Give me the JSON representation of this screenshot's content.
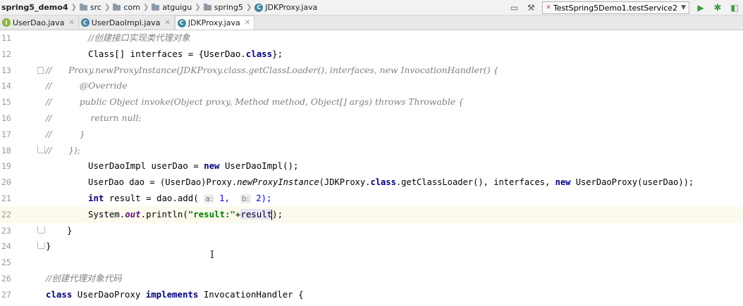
{
  "breadcrumb": {
    "project": "spring5_demo4",
    "items": [
      "src",
      "com",
      "atguigu",
      "spring5"
    ],
    "file": "JDKProxy.java"
  },
  "toolbar": {
    "run_config": "TestSpring5Demo1.testService2"
  },
  "tabs": [
    {
      "label": "UserDao.java",
      "kind": "interface",
      "active": false
    },
    {
      "label": "UserDaoImpl.java",
      "kind": "class",
      "active": false
    },
    {
      "label": "JDKProxy.java",
      "kind": "class",
      "active": true
    }
  ],
  "editor": {
    "line_numbers": [
      "11",
      "12",
      "13",
      "14",
      "15",
      "16",
      "17",
      "18",
      "19",
      "20",
      "21",
      "22",
      "23",
      "24",
      "25",
      "26",
      "27"
    ],
    "lines": {
      "l11": "//创建接口实现类代理对象",
      "l12a": "Class[] interfaces = {UserDao.",
      "l12b": "class",
      "l12c": "};",
      "l13": "//      Proxy.newProxyInstance(JDKProxy.class.getClassLoader(), interfaces, new InvocationHandler() {",
      "l14": "//          @Override",
      "l15": "//          public Object invoke(Object proxy, Method method, Object[] args) throws Throwable {",
      "l16": "//              return null;",
      "l17": "//          }",
      "l18": "//      });",
      "l19a": "UserDaoImpl userDao = ",
      "l19b": "new",
      "l19c": " UserDaoImpl();",
      "l20a": "UserDao dao = (UserDao)Proxy.",
      "l20b": "newProxyInstance",
      "l20c": "(JDKProxy.",
      "l20d": "class",
      "l20e": ".getClassLoader(), interfaces, ",
      "l20f": "new",
      "l20g": " UserDaoProxy(userDao));",
      "l21a": "int",
      "l21b": " result = dao.add( ",
      "l21hint1": "a:",
      "l21v1": " 1, ",
      "l21hint2": "b:",
      "l21v2": " 2);",
      "l22a": "System.",
      "l22b": "out",
      "l22c": ".println(",
      "l22d": "\"result:\"",
      "l22e": "+",
      "l22f": "result",
      "l22g": ");",
      "l23": "}",
      "l24": "}",
      "l26": "//创建代理对象代码",
      "l27a": "class",
      "l27b": " UserDaoProxy ",
      "l27c": "implements",
      "l27d": " InvocationHandler {"
    }
  }
}
